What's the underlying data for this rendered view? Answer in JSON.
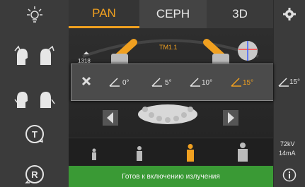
{
  "tabs": {
    "pan": "PAN",
    "ceph": "CEPH",
    "threed": "3D"
  },
  "main": {
    "tm_label": "TM1.1",
    "value_label": "1318"
  },
  "tilt_popup": {
    "options": [
      "0°",
      "5°",
      "10°",
      "15°"
    ],
    "selected": "15°",
    "current": "15°"
  },
  "right_bar": {
    "kv": "72kV",
    "ma": "14mA"
  },
  "left_bar": {
    "t_button": "T",
    "r_button": "R"
  },
  "status": {
    "text": "Готов к включению излучения"
  },
  "colors": {
    "accent": "#f0a020",
    "status_bg": "#3a9a35",
    "panel": "#3b3b3b"
  }
}
